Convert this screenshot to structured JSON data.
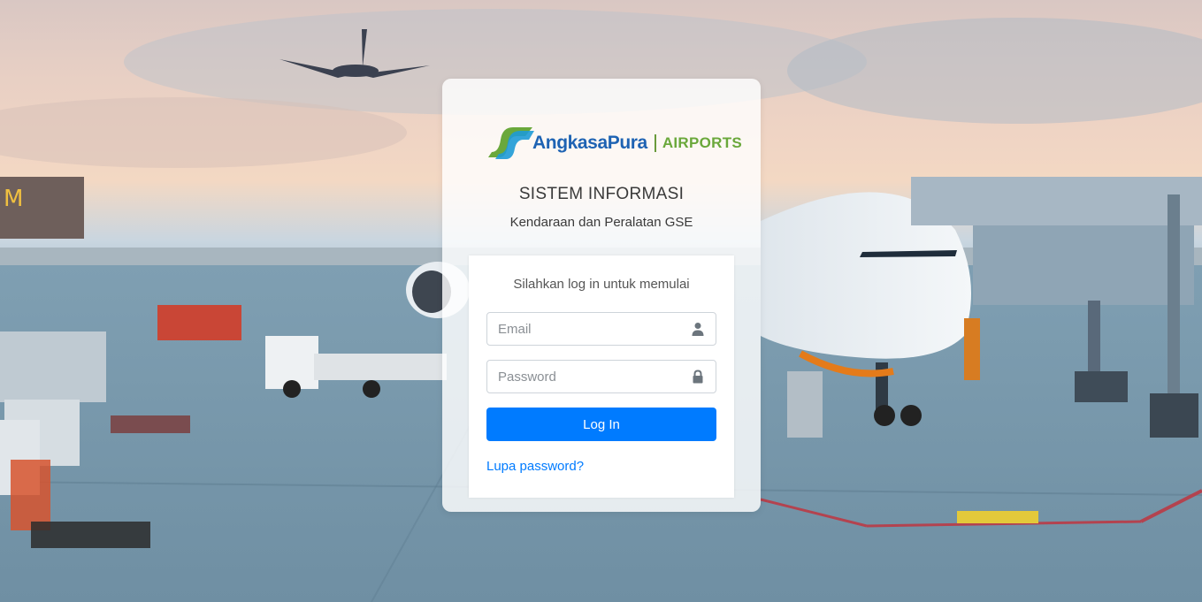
{
  "brand": {
    "name": "AngkasaPura",
    "suffix": "AIRPORTS",
    "primary_color": "#1e63b3",
    "accent_color": "#6aa83b"
  },
  "header": {
    "title": "SISTEM INFORMASI",
    "subtitle": "Kendaraan dan Peralatan GSE"
  },
  "login": {
    "message": "Silahkan log in untuk memulai",
    "email": {
      "placeholder": "Email",
      "value": "",
      "icon": "user-icon"
    },
    "password": {
      "placeholder": "Password",
      "value": "",
      "icon": "lock-icon"
    },
    "submit_label": "Log In",
    "forgot_label": "Lupa password?",
    "button_color": "#007bff"
  },
  "background": {
    "description_icon": "airport-apron-photo",
    "gate_sign": "M"
  }
}
